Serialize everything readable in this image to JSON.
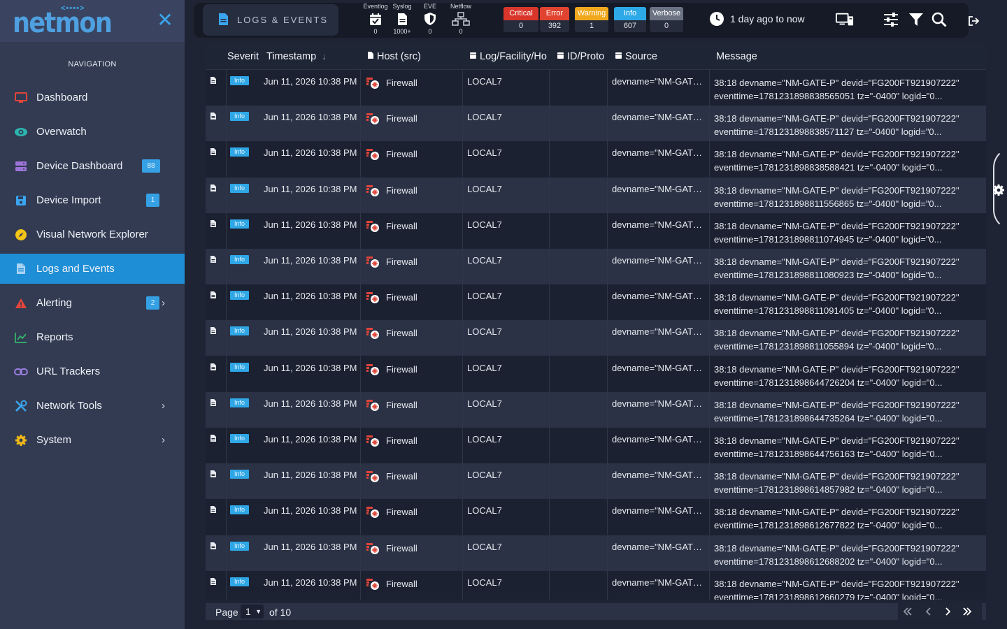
{
  "brand": {
    "logo_text": "netmon",
    "logo_dots": "<••••>"
  },
  "sidebar": {
    "header": "NAVIGATION",
    "items": [
      {
        "label": "Dashboard",
        "icon": "monitor-icon",
        "color": "#e0453a"
      },
      {
        "label": "Overwatch",
        "icon": "eye-icon",
        "color": "#2bb5b0"
      },
      {
        "label": "Device Dashboard",
        "icon": "server-icon",
        "color": "#9c73d6",
        "badge": "88"
      },
      {
        "label": "Device Import",
        "icon": "floppy-icon",
        "color": "#3aa5ee",
        "badge": "1"
      },
      {
        "label": "Visual Network Explorer",
        "icon": "compass-icon",
        "color": "#f5c518"
      },
      {
        "label": "Logs and Events",
        "icon": "document-icon",
        "color": "#9cc9f0",
        "active": true
      },
      {
        "label": "Alerting",
        "icon": "warning-icon",
        "color": "#e8453a",
        "badge": "2",
        "chevron": true
      },
      {
        "label": "Reports",
        "icon": "chart-line-icon",
        "color": "#35b56b"
      },
      {
        "label": "URL Trackers",
        "icon": "link-icon",
        "color": "#9a7de0"
      },
      {
        "label": "Network Tools",
        "icon": "tools-icon",
        "color": "#3aa5ee",
        "chevron": true
      },
      {
        "label": "System",
        "icon": "gear-icon",
        "color": "#f0b816",
        "chevron": true
      }
    ]
  },
  "topbar": {
    "page_title": "LOGS & EVENTS",
    "sources": [
      {
        "label": "Eventlog",
        "count": "0",
        "icon": "calendar-check-icon"
      },
      {
        "label": "Syslog",
        "count": "1000+",
        "icon": "syslog-doc-icon"
      },
      {
        "label": "EVE",
        "count": "0",
        "icon": "shield-icon"
      },
      {
        "label": "Netflow",
        "count": "0",
        "icon": "network-icon"
      }
    ],
    "severities": [
      {
        "label": "Critical",
        "count": "0",
        "color": "#d9362b"
      },
      {
        "label": "Error",
        "count": "392",
        "color": "#e0432f"
      },
      {
        "label": "Warning",
        "count": "1",
        "color": "#f0a81c"
      },
      {
        "label": "Info",
        "count": "607",
        "color": "#2ea9e8"
      },
      {
        "label": "Verbose",
        "count": "0",
        "color": "#6b7383"
      }
    ],
    "time_range": "1 day ago to now"
  },
  "table": {
    "columns": [
      "Severit",
      "Timestamp",
      "Host (src)",
      "Log/Facility/Ho",
      "ID/Proto",
      "Source",
      "Message"
    ],
    "rows": [
      {
        "severity": "Info",
        "timestamp": "Jun 11, 2026 10:38 PM",
        "host": "Firewall",
        "facility": "LOCAL7",
        "id": "",
        "source": "devname=\"NM-GAT…",
        "msg1": "38:18 devname=\"NM-GATE-P\" devid=\"FG200FT921907222\"",
        "msg2": "eventtime=1781231898838565051 tz=\"-0400\" logid=\"0..."
      },
      {
        "severity": "Info",
        "timestamp": "Jun 11, 2026 10:38 PM",
        "host": "Firewall",
        "facility": "LOCAL7",
        "id": "",
        "source": "devname=\"NM-GAT…",
        "msg1": "38:18 devname=\"NM-GATE-P\" devid=\"FG200FT921907222\"",
        "msg2": "eventtime=1781231898838571127 tz=\"-0400\" logid=\"0..."
      },
      {
        "severity": "Info",
        "timestamp": "Jun 11, 2026 10:38 PM",
        "host": "Firewall",
        "facility": "LOCAL7",
        "id": "",
        "source": "devname=\"NM-GAT…",
        "msg1": "38:18 devname=\"NM-GATE-P\" devid=\"FG200FT921907222\"",
        "msg2": "eventtime=1781231898838588421 tz=\"-0400\" logid=\"0..."
      },
      {
        "severity": "Info",
        "timestamp": "Jun 11, 2026 10:38 PM",
        "host": "Firewall",
        "facility": "LOCAL7",
        "id": "",
        "source": "devname=\"NM-GAT…",
        "msg1": "38:18 devname=\"NM-GATE-P\" devid=\"FG200FT921907222\"",
        "msg2": "eventtime=1781231898811556865 tz=\"-0400\" logid=\"0..."
      },
      {
        "severity": "Info",
        "timestamp": "Jun 11, 2026 10:38 PM",
        "host": "Firewall",
        "facility": "LOCAL7",
        "id": "",
        "source": "devname=\"NM-GAT…",
        "msg1": "38:18 devname=\"NM-GATE-P\" devid=\"FG200FT921907222\"",
        "msg2": "eventtime=1781231898811074945 tz=\"-0400\" logid=\"0..."
      },
      {
        "severity": "Info",
        "timestamp": "Jun 11, 2026 10:38 PM",
        "host": "Firewall",
        "facility": "LOCAL7",
        "id": "",
        "source": "devname=\"NM-GAT…",
        "msg1": "38:18 devname=\"NM-GATE-P\" devid=\"FG200FT921907222\"",
        "msg2": "eventtime=1781231898811080923 tz=\"-0400\" logid=\"0..."
      },
      {
        "severity": "Info",
        "timestamp": "Jun 11, 2026 10:38 PM",
        "host": "Firewall",
        "facility": "LOCAL7",
        "id": "",
        "source": "devname=\"NM-GAT…",
        "msg1": "38:18 devname=\"NM-GATE-P\" devid=\"FG200FT921907222\"",
        "msg2": "eventtime=1781231898811091405 tz=\"-0400\" logid=\"0..."
      },
      {
        "severity": "Info",
        "timestamp": "Jun 11, 2026 10:38 PM",
        "host": "Firewall",
        "facility": "LOCAL7",
        "id": "",
        "source": "devname=\"NM-GAT…",
        "msg1": "38:18 devname=\"NM-GATE-P\" devid=\"FG200FT921907222\"",
        "msg2": "eventtime=1781231898811055894 tz=\"-0400\" logid=\"0..."
      },
      {
        "severity": "Info",
        "timestamp": "Jun 11, 2026 10:38 PM",
        "host": "Firewall",
        "facility": "LOCAL7",
        "id": "",
        "source": "devname=\"NM-GAT…",
        "msg1": "38:18 devname=\"NM-GATE-P\" devid=\"FG200FT921907222\"",
        "msg2": "eventtime=1781231898644726204 tz=\"-0400\" logid=\"0..."
      },
      {
        "severity": "Info",
        "timestamp": "Jun 11, 2026 10:38 PM",
        "host": "Firewall",
        "facility": "LOCAL7",
        "id": "",
        "source": "devname=\"NM-GAT…",
        "msg1": "38:18 devname=\"NM-GATE-P\" devid=\"FG200FT921907222\"",
        "msg2": "eventtime=1781231898644735264 tz=\"-0400\" logid=\"0..."
      },
      {
        "severity": "Info",
        "timestamp": "Jun 11, 2026 10:38 PM",
        "host": "Firewall",
        "facility": "LOCAL7",
        "id": "",
        "source": "devname=\"NM-GAT…",
        "msg1": "38:18 devname=\"NM-GATE-P\" devid=\"FG200FT921907222\"",
        "msg2": "eventtime=1781231898644756163 tz=\"-0400\" logid=\"0..."
      },
      {
        "severity": "Info",
        "timestamp": "Jun 11, 2026 10:38 PM",
        "host": "Firewall",
        "facility": "LOCAL7",
        "id": "",
        "source": "devname=\"NM-GAT…",
        "msg1": "38:18 devname=\"NM-GATE-P\" devid=\"FG200FT921907222\"",
        "msg2": "eventtime=1781231898614857982 tz=\"-0400\" logid=\"0..."
      },
      {
        "severity": "Info",
        "timestamp": "Jun 11, 2026 10:38 PM",
        "host": "Firewall",
        "facility": "LOCAL7",
        "id": "",
        "source": "devname=\"NM-GAT…",
        "msg1": "38:18 devname=\"NM-GATE-P\" devid=\"FG200FT921907222\"",
        "msg2": "eventtime=1781231898612677822 tz=\"-0400\" logid=\"0..."
      },
      {
        "severity": "Info",
        "timestamp": "Jun 11, 2026 10:38 PM",
        "host": "Firewall",
        "facility": "LOCAL7",
        "id": "",
        "source": "devname=\"NM-GAT…",
        "msg1": "38:18 devname=\"NM-GATE-P\" devid=\"FG200FT921907222\"",
        "msg2": "eventtime=1781231898612688202 tz=\"-0400\" logid=\"0..."
      },
      {
        "severity": "Info",
        "timestamp": "Jun 11, 2026 10:38 PM",
        "host": "Firewall",
        "facility": "LOCAL7",
        "id": "",
        "source": "devname=\"NM-GAT…",
        "msg1": "38:18 devname=\"NM-GATE-P\" devid=\"FG200FT921907222\"",
        "msg2": "eventtime=1781231898612660279 tz=\"-0400\" logid=\"0..."
      }
    ]
  },
  "pagination": {
    "page_label": "Page",
    "current_page": "1",
    "of_label": "of 10"
  }
}
